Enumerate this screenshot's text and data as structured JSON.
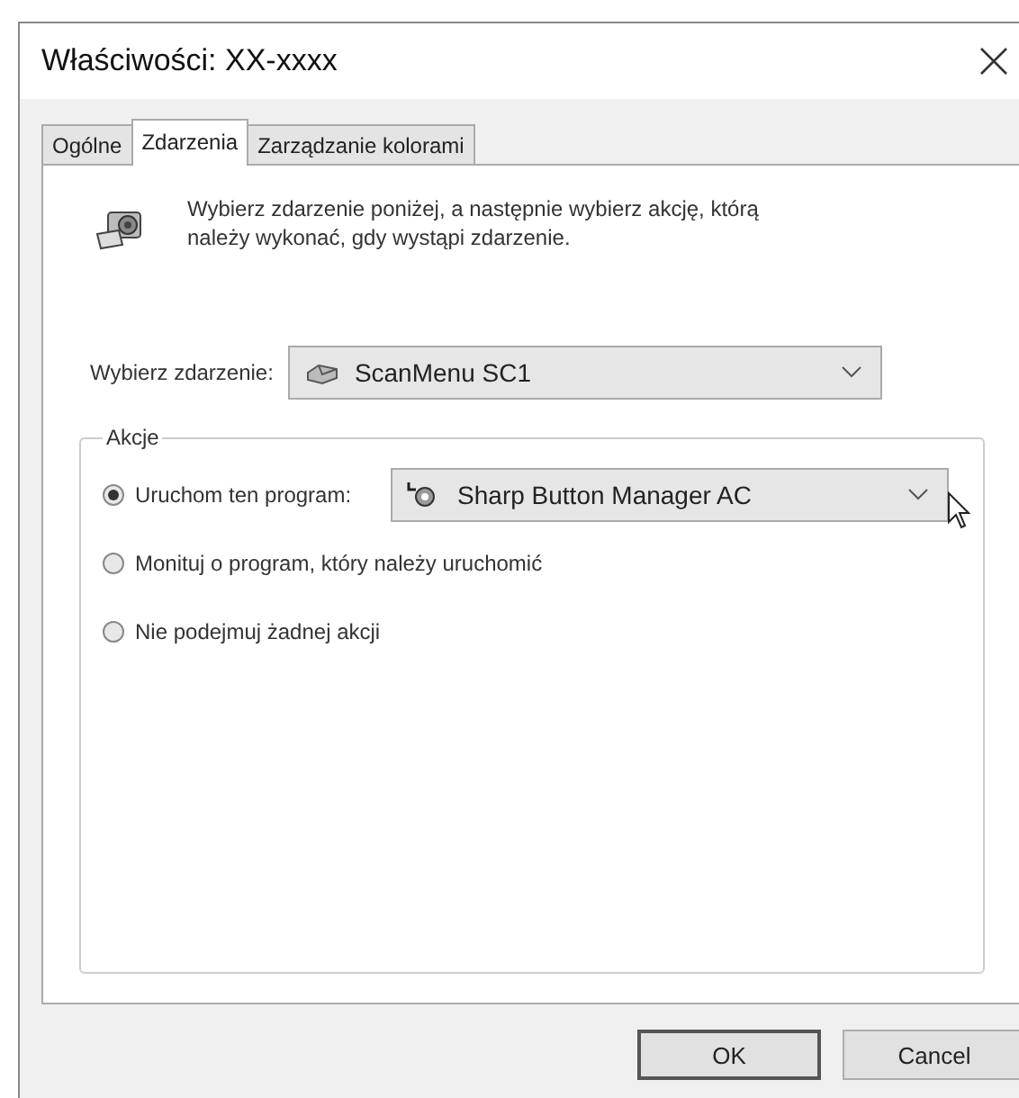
{
  "window": {
    "title": "Właściwości: XX-xxxx"
  },
  "tabs": [
    {
      "label": "Ogólne",
      "selected": false
    },
    {
      "label": "Zdarzenia",
      "selected": true
    },
    {
      "label": "Zarządzanie kolorami",
      "selected": false
    }
  ],
  "intro": "Wybierz zdarzenie poniżej, a następnie wybierz akcję, którą należy wykonać, gdy wystąpi zdarzenie.",
  "event_select": {
    "label": "Wybierz zdarzenie:",
    "value": "ScanMenu SC1"
  },
  "actions": {
    "title": "Akcje",
    "options": [
      {
        "label": "Uruchom ten program:",
        "selected": true,
        "program": "Sharp Button Manager AC"
      },
      {
        "label": "Monituj o program, który należy uruchomić",
        "selected": false
      },
      {
        "label": "Nie podejmuj żadnej akcji",
        "selected": false
      }
    ]
  },
  "buttons": [
    {
      "label": "OK",
      "default": true
    },
    {
      "label": "Cancel",
      "default": false
    }
  ]
}
